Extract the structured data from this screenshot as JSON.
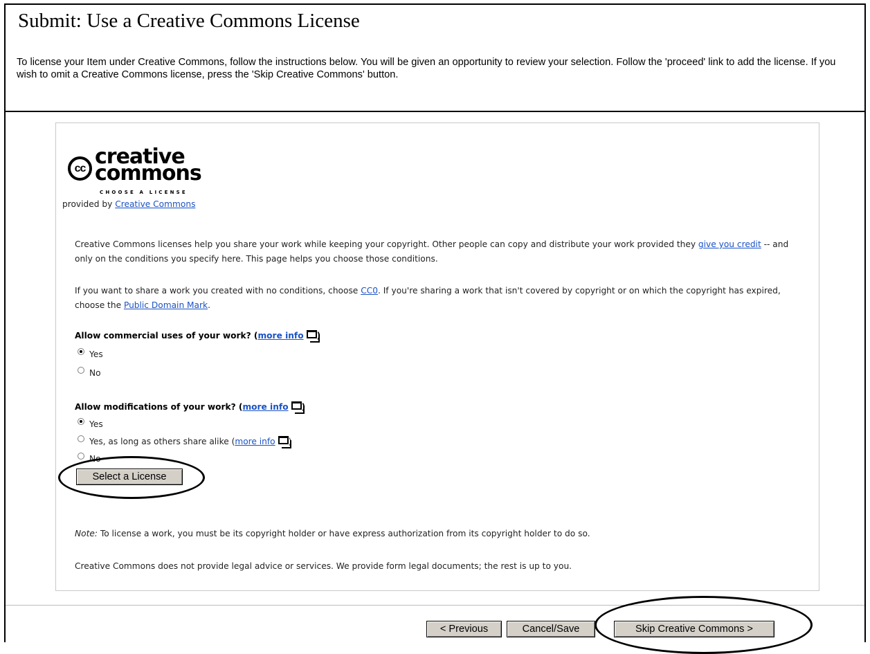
{
  "header": {
    "title": "Submit: Use a Creative Commons License",
    "intro": "To license your Item under Creative Commons, follow the instructions below. You will be given an opportunity to review your selection. Follow the 'proceed' link to add the license. If you wish to omit a Creative Commons license, press the 'Skip Creative Commons' button."
  },
  "logo": {
    "cc_mark": "cc",
    "word1": "creative",
    "word2": "commons",
    "tagline": "CHOOSE A LICENSE"
  },
  "provided": {
    "prefix": "provided by ",
    "link": "Creative Commons"
  },
  "paragraph1": {
    "part1": "Creative Commons licenses help you share your work while keeping your copyright. Other people can copy and distribute your work provided they ",
    "link": "give you credit",
    "part2": " -- and only on the conditions you specify here. This page helps you choose those conditions."
  },
  "paragraph2": {
    "part1": "If you want to share a work you created with no conditions, choose ",
    "link1": "CC0",
    "part2": ". If you're sharing a work that isn't covered by copyright or on which the copyright has expired, choose the ",
    "link2": "Public Domain Mark",
    "part3": "."
  },
  "question_commercial": {
    "label": "Allow commercial uses of your work? (",
    "more_info": "more info",
    "close": ")",
    "options": [
      "Yes",
      "No"
    ],
    "selected": "Yes"
  },
  "question_modifications": {
    "label": "Allow modifications of your work? (",
    "more_info": "more info",
    "close": ")",
    "options": [
      "Yes",
      "Yes, as long as others share alike (",
      "No"
    ],
    "share_alike_more_info": "more info",
    "share_alike_close": ")",
    "selected": "Yes"
  },
  "select_button": "Select a License",
  "note": {
    "label": "Note:",
    "text": " To license a work, you must be its copyright holder or have express authorization from its copyright holder to do so."
  },
  "legal": "Creative Commons does not provide legal advice or services. We provide form legal documents; the rest is up to you.",
  "footer": {
    "previous": "< Previous",
    "cancel": "Cancel/Save",
    "skip": "Skip Creative Commons >"
  },
  "icons": {
    "new_window": "new-window-icon",
    "annotation": "ellipse-highlight"
  },
  "colors": {
    "link": "#1a52c4",
    "button_face": "#d4d0c8"
  }
}
